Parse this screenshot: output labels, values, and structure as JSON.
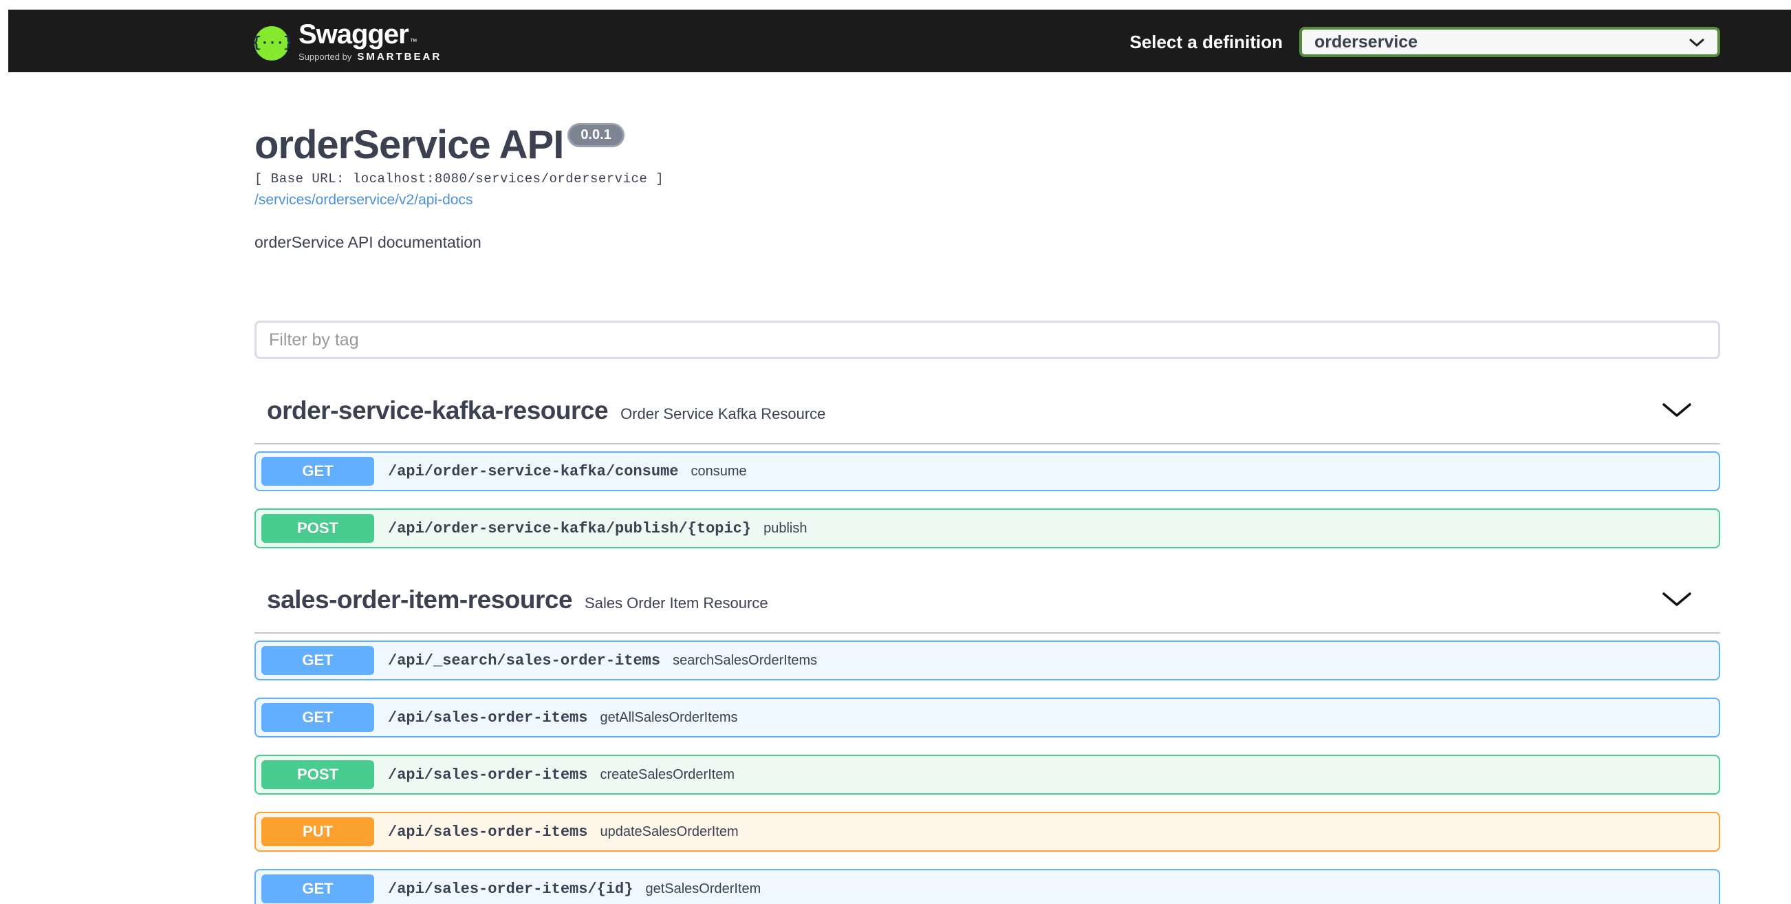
{
  "topbar": {
    "brand": {
      "logo_glyph": "{···}",
      "name": "Swagger",
      "tm": "™",
      "supported_prefix": "Supported by",
      "supported_brand": "SMARTBEAR"
    },
    "definition_label": "Select a definition",
    "definition_value": "orderservice"
  },
  "info": {
    "title": "orderService API",
    "version_badge": "0.0.1",
    "base_url_line": "[ Base URL: localhost:8080/services/orderservice ]",
    "spec_link": "/services/orderservice/v2/api-docs",
    "description": "orderService API documentation"
  },
  "filter": {
    "placeholder": "Filter by tag"
  },
  "colors": {
    "topbar_bg": "#1b1b1b",
    "logo_green": "#85ea2d",
    "select_border_green": "#558c3c",
    "text_dark": "#3b4151",
    "link_blue": "#4990e2",
    "version_pill_gray": "#7d8492",
    "method_get": "#61affe",
    "method_post": "#49cc90",
    "method_put": "#fca130"
  },
  "sections": [
    {
      "title": "order-service-kafka-resource",
      "subtitle": "Order Service Kafka Resource",
      "operations": [
        {
          "method": "GET",
          "path": "/api/order-service-kafka/consume",
          "summary": "consume"
        },
        {
          "method": "POST",
          "path": "/api/order-service-kafka/publish/{topic}",
          "summary": "publish"
        }
      ]
    },
    {
      "title": "sales-order-item-resource",
      "subtitle": "Sales Order Item Resource",
      "operations": [
        {
          "method": "GET",
          "path": "/api/_search/sales-order-items",
          "summary": "searchSalesOrderItems"
        },
        {
          "method": "GET",
          "path": "/api/sales-order-items",
          "summary": "getAllSalesOrderItems"
        },
        {
          "method": "POST",
          "path": "/api/sales-order-items",
          "summary": "createSalesOrderItem"
        },
        {
          "method": "PUT",
          "path": "/api/sales-order-items",
          "summary": "updateSalesOrderItem"
        },
        {
          "method": "GET",
          "path": "/api/sales-order-items/{id}",
          "summary": "getSalesOrderItem"
        }
      ]
    }
  ]
}
